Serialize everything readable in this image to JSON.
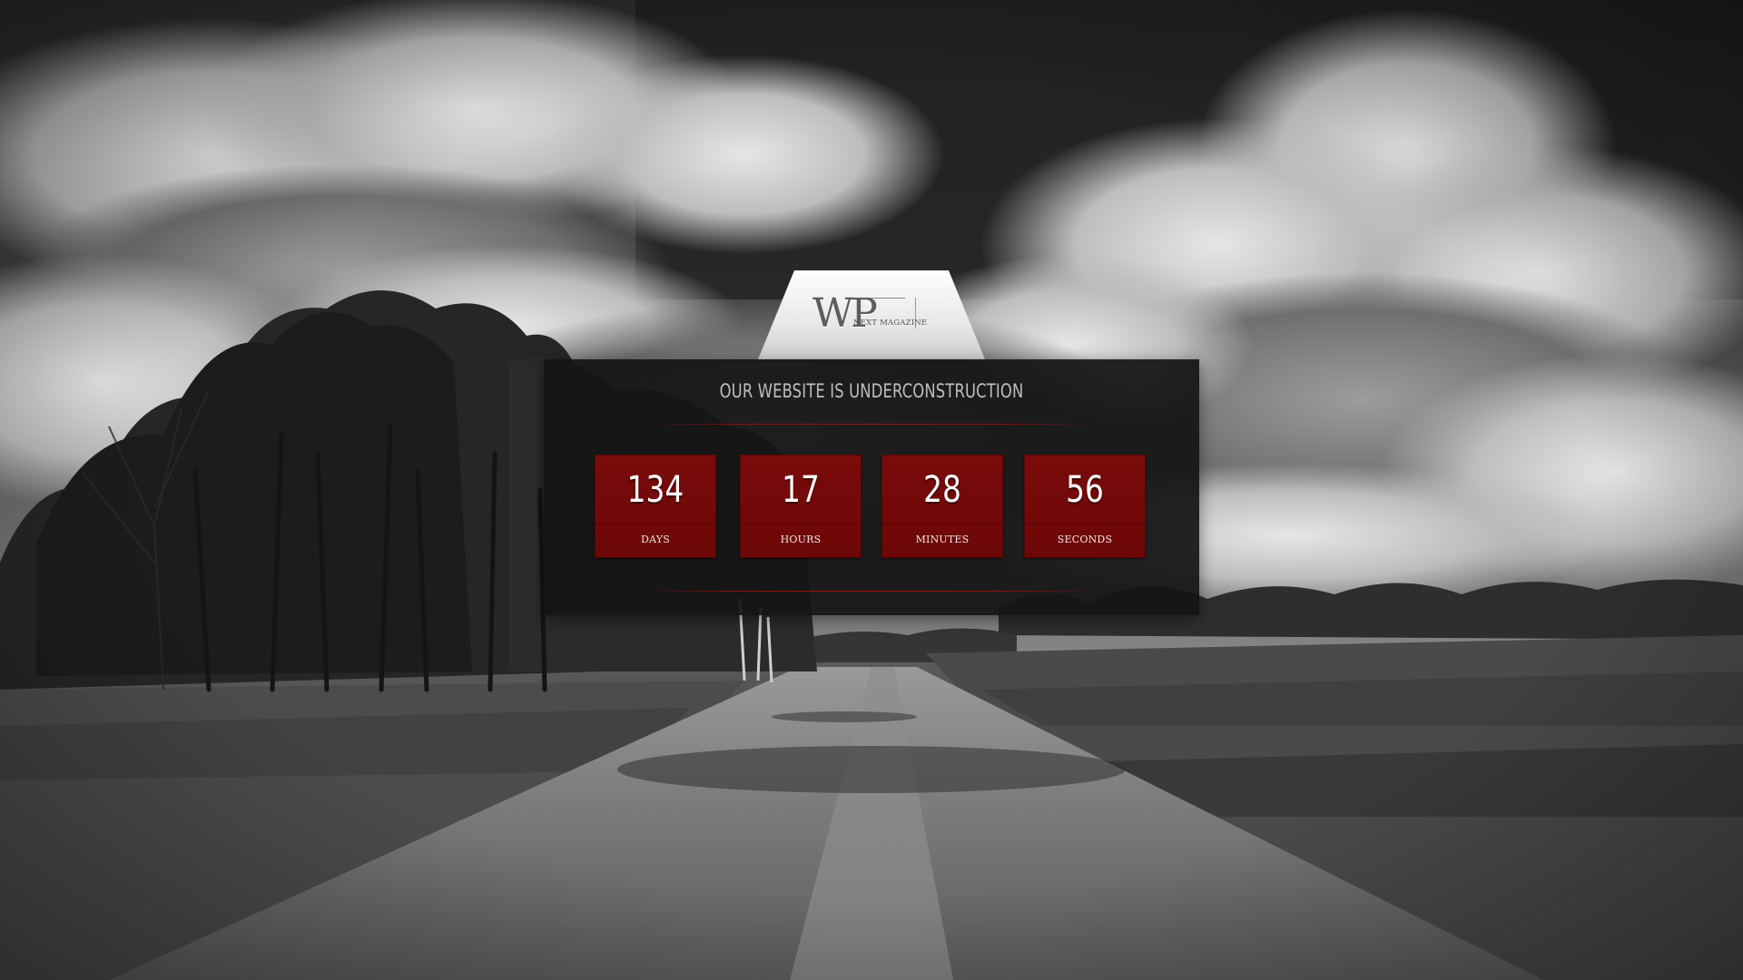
{
  "logo": {
    "letters": "WP",
    "subtitle": "NEXT MAGAZINE"
  },
  "panel": {
    "headline": "OUR WEBSITE IS UNDERCONSTRUCTION"
  },
  "countdown": [
    {
      "value": "134",
      "label": "DAYS"
    },
    {
      "value": "17",
      "label": "HOURS"
    },
    {
      "value": "28",
      "label": "MINUTES"
    },
    {
      "value": "56",
      "label": "SECONDS"
    }
  ],
  "colors": {
    "accent_red": "#7a0b0b",
    "panel_bg": "#141414",
    "headline_text": "#bfbfbf"
  }
}
